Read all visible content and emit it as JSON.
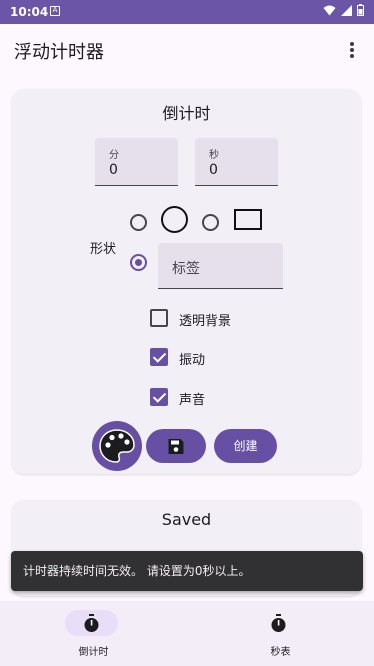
{
  "status_bar": {
    "time": "10:04",
    "notification_glyph": "A"
  },
  "app_bar": {
    "title": "浮动计时器"
  },
  "countdown_card": {
    "title": "倒计时",
    "minutes": {
      "label": "分",
      "value": "0"
    },
    "seconds": {
      "label": "秒",
      "value": "0"
    },
    "shape_label": "形状",
    "shape_options": [
      "circle",
      "square",
      "label"
    ],
    "selected_shape": "label",
    "label_field_placeholder": "标签",
    "checkboxes": [
      {
        "label": "透明背景",
        "checked": false
      },
      {
        "label": "振动",
        "checked": true
      },
      {
        "label": "声音",
        "checked": true
      }
    ],
    "create_label": "创建"
  },
  "saved_card": {
    "title": "Saved"
  },
  "snackbar": {
    "message": "计时器持续时间无效。 请设置为0秒以上。"
  },
  "bottom_nav": {
    "items": [
      {
        "label": "倒计时",
        "icon": "timer-icon",
        "active": true
      },
      {
        "label": "秒表",
        "icon": "stopwatch-icon",
        "active": false
      }
    ]
  },
  "colors": {
    "accent": "#6750a4",
    "status_bar": "#6a55a6",
    "snackbar": "#313033"
  }
}
